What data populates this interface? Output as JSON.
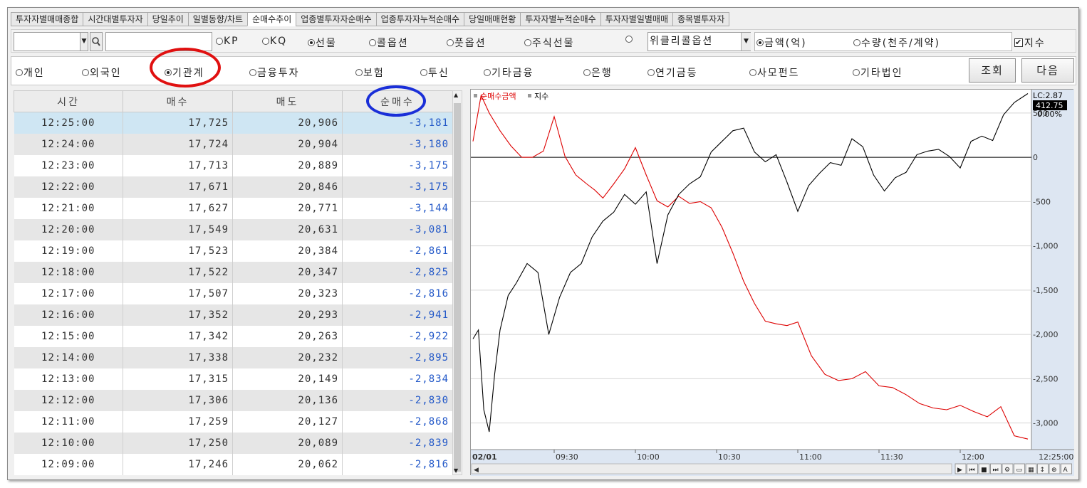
{
  "tabs": [
    "투자자별매매종합",
    "시간대별투자자",
    "당일추이",
    "일별동향/차트",
    "순매수추이",
    "업종별투자자순매수",
    "업종투자자누적순매수",
    "당일매매현황",
    "투자자별누적순매수",
    "투자자별일별매매",
    "종목별투자자"
  ],
  "active_tab": 4,
  "market_options": [
    {
      "label": "KP",
      "selected": false
    },
    {
      "label": "KQ",
      "selected": false
    },
    {
      "label": "선물",
      "selected": true
    },
    {
      "label": "콜옵션",
      "selected": false
    },
    {
      "label": "풋옵션",
      "selected": false
    },
    {
      "label": "주식선물",
      "selected": false
    },
    {
      "label": "",
      "selected": false
    }
  ],
  "weekly_option_value": "위클리콜옵션",
  "unit_options": [
    {
      "label": "금액(억)",
      "selected": true
    },
    {
      "label": "수량(천주/계약)",
      "selected": false
    }
  ],
  "index_checkbox": {
    "label": "지수",
    "checked": true
  },
  "investor_options": [
    {
      "label": "개인",
      "selected": false
    },
    {
      "label": "외국인",
      "selected": false
    },
    {
      "label": "기관계",
      "selected": true
    },
    {
      "label": "금융투자",
      "selected": false
    },
    {
      "label": "보험",
      "selected": false
    },
    {
      "label": "투신",
      "selected": false
    },
    {
      "label": "기타금융",
      "selected": false
    },
    {
      "label": "은행",
      "selected": false
    },
    {
      "label": "연기금등",
      "selected": false
    },
    {
      "label": "사모펀드",
      "selected": false
    },
    {
      "label": "기타법인",
      "selected": false
    }
  ],
  "buttons": {
    "search": "조회",
    "next": "다음"
  },
  "table": {
    "headers": [
      "시간",
      "매수",
      "매도",
      "순매수"
    ],
    "rows": [
      [
        "12:25:00",
        "17,725",
        "20,906",
        "-3,181"
      ],
      [
        "12:24:00",
        "17,724",
        "20,904",
        "-3,180"
      ],
      [
        "12:23:00",
        "17,713",
        "20,889",
        "-3,175"
      ],
      [
        "12:22:00",
        "17,671",
        "20,846",
        "-3,175"
      ],
      [
        "12:21:00",
        "17,627",
        "20,771",
        "-3,144"
      ],
      [
        "12:20:00",
        "17,549",
        "20,631",
        "-3,081"
      ],
      [
        "12:19:00",
        "17,523",
        "20,384",
        "-2,861"
      ],
      [
        "12:18:00",
        "17,522",
        "20,347",
        "-2,825"
      ],
      [
        "12:17:00",
        "17,507",
        "20,323",
        "-2,816"
      ],
      [
        "12:16:00",
        "17,352",
        "20,293",
        "-2,941"
      ],
      [
        "12:15:00",
        "17,342",
        "20,263",
        "-2,922"
      ],
      [
        "12:14:00",
        "17,338",
        "20,232",
        "-2,895"
      ],
      [
        "12:13:00",
        "17,315",
        "20,149",
        "-2,834"
      ],
      [
        "12:12:00",
        "17,306",
        "20,136",
        "-2,830"
      ],
      [
        "12:11:00",
        "17,259",
        "20,127",
        "-2,868"
      ],
      [
        "12:10:00",
        "17,250",
        "20,089",
        "-2,839"
      ],
      [
        "12:09:00",
        "17,246",
        "20,062",
        "-2,816"
      ]
    ]
  },
  "chart_data": {
    "type": "line",
    "legend": [
      "순매수금액",
      "지수"
    ],
    "y_ticks": [
      500,
      0,
      -500,
      -1000,
      -1500,
      -2000,
      -2500,
      -3000
    ],
    "y_tick_labels": [
      "500",
      "0",
      "-500",
      "-1,000",
      "-1,500",
      "-2,000",
      "-2,500",
      "-3,000"
    ],
    "ylim": [
      -3300,
      700
    ],
    "x_ticks": [
      "02/01",
      "09:30",
      "10:00",
      "10:30",
      "11:00",
      "11:30",
      "12:00"
    ],
    "x_end_label": "12:25:00",
    "right_badges": {
      "lc": "LC:2.87",
      "last": "412.75",
      "pct": "0.00%"
    },
    "series": [
      {
        "name": "순매수금액",
        "color": "#dd0000",
        "x_minutes": [
          0,
          3,
          6,
          10,
          14,
          18,
          22,
          26,
          30,
          34,
          38,
          42,
          45,
          48,
          52,
          56,
          60,
          64,
          68,
          72,
          76,
          80,
          84,
          88,
          92,
          96,
          100,
          104,
          108,
          112,
          116,
          120,
          125,
          130,
          135,
          140,
          145,
          150,
          155,
          160,
          165,
          170,
          175,
          180,
          185,
          190,
          195,
          200,
          205
        ],
        "values": [
          180,
          700,
          500,
          300,
          130,
          0,
          0,
          70,
          460,
          10,
          -200,
          -300,
          -370,
          -460,
          -300,
          -130,
          110,
          -200,
          -490,
          -560,
          -440,
          -520,
          -500,
          -570,
          -790,
          -1080,
          -1400,
          -1650,
          -1850,
          -1880,
          -1900,
          -1860,
          -2240,
          -2450,
          -2520,
          -2500,
          -2420,
          -2580,
          -2600,
          -2680,
          -2780,
          -2830,
          -2850,
          -2800,
          -2870,
          -2930,
          -2816,
          -3144,
          -3181
        ]
      },
      {
        "name": "지수",
        "color": "#000000",
        "x_minutes": [
          0,
          2,
          4,
          6,
          8,
          10,
          13,
          16,
          20,
          24,
          28,
          32,
          36,
          40,
          44,
          48,
          52,
          56,
          60,
          64,
          68,
          72,
          76,
          80,
          84,
          88,
          92,
          96,
          100,
          104,
          108,
          112,
          116,
          120,
          124,
          128,
          132,
          136,
          140,
          144,
          148,
          152,
          156,
          160,
          164,
          168,
          172,
          176,
          180,
          184,
          188,
          192,
          196,
          200,
          205
        ],
        "values": [
          -2050,
          -1950,
          -2850,
          -3100,
          -2450,
          -1950,
          -1560,
          -1420,
          -1200,
          -1300,
          -2000,
          -1580,
          -1300,
          -1200,
          -900,
          -720,
          -620,
          -420,
          -530,
          -390,
          -1200,
          -650,
          -420,
          -300,
          -220,
          60,
          180,
          300,
          330,
          60,
          -50,
          30,
          -280,
          -610,
          -320,
          -180,
          -60,
          -90,
          210,
          120,
          -200,
          -380,
          -230,
          -170,
          30,
          70,
          90,
          10,
          -120,
          180,
          240,
          190,
          480,
          620,
          720
        ]
      }
    ]
  }
}
